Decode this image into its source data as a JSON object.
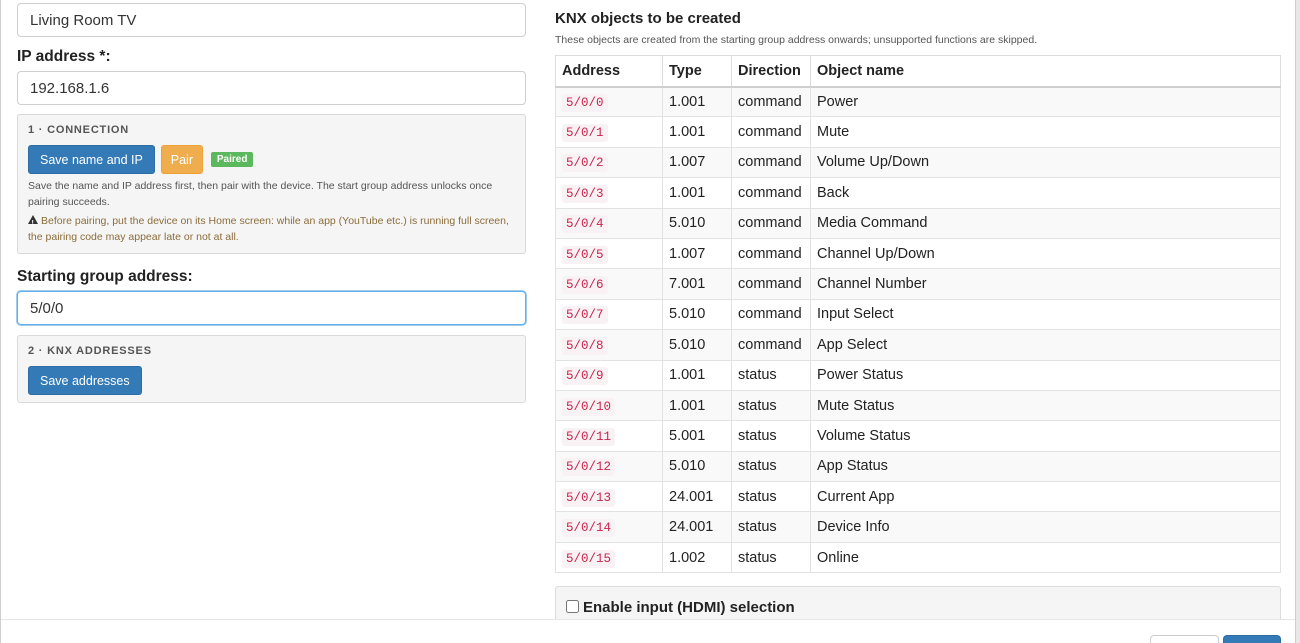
{
  "device": {
    "name_value": "Living Room TV",
    "ip_label": "IP address *:",
    "ip_value": "192.168.1.6"
  },
  "connection": {
    "title": "1 · CONNECTION",
    "save_button": "Save name and IP",
    "pair_button": "Pair",
    "status_badge": "Paired",
    "help": "Save the name and IP address first, then pair with the device. The start group address unlocks once pairing succeeds.",
    "warning": "Before pairing, put the device on its Home screen: while an app (YouTube etc.) is running full screen, the pairing code may appear late or not at all."
  },
  "group": {
    "label": "Starting group address:",
    "value": "5/0/0"
  },
  "addresses": {
    "title": "2 · KNX ADDRESSES",
    "save_button": "Save addresses"
  },
  "objects": {
    "title": "KNX objects to be created",
    "subtitle": "These objects are created from the starting group address onwards; unsupported functions are skipped.",
    "columns": [
      "Address",
      "Type",
      "Direction",
      "Object name"
    ],
    "rows": [
      [
        "5/0/0",
        "1.001",
        "command",
        "Power"
      ],
      [
        "5/0/1",
        "1.001",
        "command",
        "Mute"
      ],
      [
        "5/0/2",
        "1.007",
        "command",
        "Volume Up/Down"
      ],
      [
        "5/0/3",
        "1.001",
        "command",
        "Back"
      ],
      [
        "5/0/4",
        "5.010",
        "command",
        "Media Command"
      ],
      [
        "5/0/5",
        "1.007",
        "command",
        "Channel Up/Down"
      ],
      [
        "5/0/6",
        "7.001",
        "command",
        "Channel Number"
      ],
      [
        "5/0/7",
        "5.010",
        "command",
        "Input Select"
      ],
      [
        "5/0/8",
        "5.010",
        "command",
        "App Select"
      ],
      [
        "5/0/9",
        "1.001",
        "status",
        "Power Status"
      ],
      [
        "5/0/10",
        "1.001",
        "status",
        "Mute Status"
      ],
      [
        "5/0/11",
        "5.001",
        "status",
        "Volume Status"
      ],
      [
        "5/0/12",
        "5.010",
        "status",
        "App Status"
      ],
      [
        "5/0/13",
        "24.001",
        "status",
        "Current App"
      ],
      [
        "5/0/14",
        "24.001",
        "status",
        "Device Info"
      ],
      [
        "5/0/15",
        "1.002",
        "status",
        "Online"
      ]
    ]
  },
  "hdmi": {
    "label": "Enable input (HDMI) selection",
    "checked": false
  },
  "colors": {
    "primary": "#337ab7",
    "warning": "#f0ad4e",
    "success": "#5cb85c",
    "address_code": "#c7254e"
  }
}
